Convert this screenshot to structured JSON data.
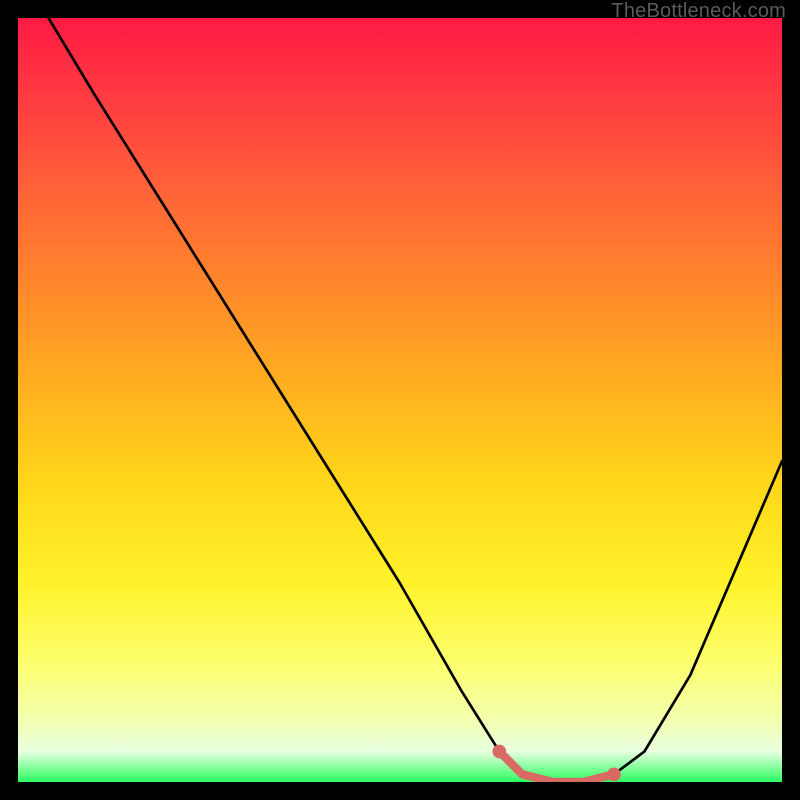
{
  "watermark": "TheBottleneck.com",
  "chart_data": {
    "type": "line",
    "title": "",
    "xlabel": "",
    "ylabel": "",
    "xlim": [
      0,
      100
    ],
    "ylim": [
      0,
      100
    ],
    "series": [
      {
        "name": "curve",
        "x": [
          4,
          10,
          20,
          30,
          40,
          50,
          58,
          63,
          66,
          70,
          74,
          78,
          82,
          88,
          94,
          100
        ],
        "y": [
          100,
          90,
          74,
          58,
          42,
          26,
          12,
          4,
          1,
          0,
          0,
          1,
          4,
          14,
          28,
          42
        ],
        "color": "#000000"
      },
      {
        "name": "highlight-segment",
        "x": [
          63,
          66,
          70,
          74,
          78
        ],
        "y": [
          4,
          1,
          0,
          0,
          1
        ],
        "color": "#d86a63",
        "stroke_width": 8
      }
    ],
    "background_gradient": {
      "stops": [
        {
          "offset": 0.0,
          "color": "#ff1a44"
        },
        {
          "offset": 0.12,
          "color": "#ff4040"
        },
        {
          "offset": 0.25,
          "color": "#ff6a35"
        },
        {
          "offset": 0.38,
          "color": "#ff9028"
        },
        {
          "offset": 0.5,
          "color": "#ffb61e"
        },
        {
          "offset": 0.62,
          "color": "#ffd91a"
        },
        {
          "offset": 0.74,
          "color": "#fff22a"
        },
        {
          "offset": 0.84,
          "color": "#fdff6a"
        },
        {
          "offset": 0.92,
          "color": "#f2ffb0"
        },
        {
          "offset": 0.96,
          "color": "#e8ffe0"
        },
        {
          "offset": 1.0,
          "color": "#2bff60"
        }
      ]
    }
  }
}
